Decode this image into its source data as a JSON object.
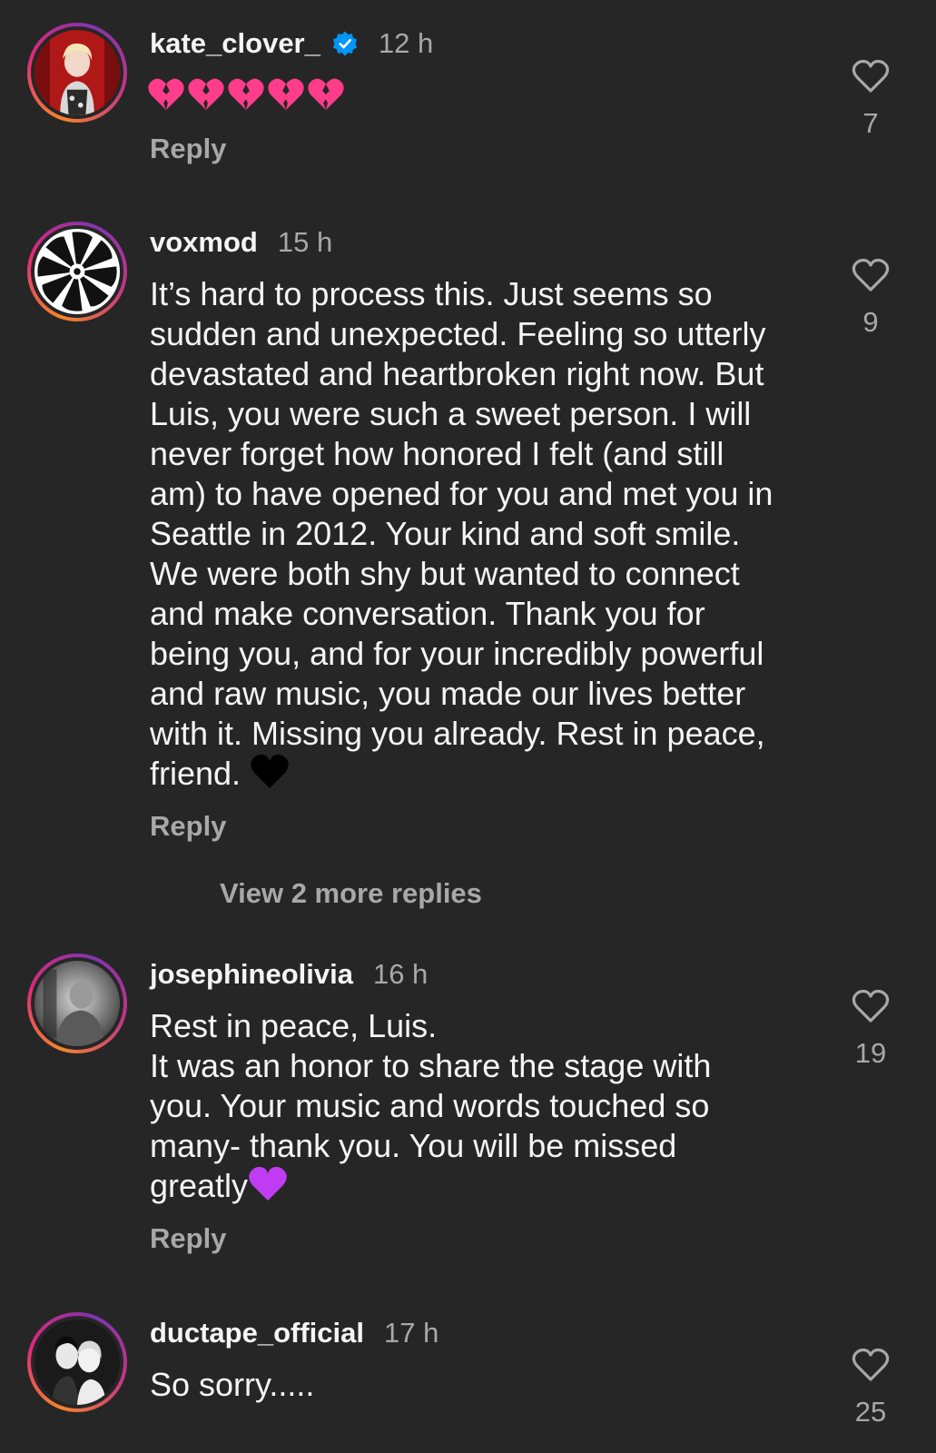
{
  "comments": [
    {
      "username": "kate_clover_",
      "verified": true,
      "time": "12 h",
      "text": "",
      "emoji": [
        "broken-heart-pink",
        "broken-heart-pink",
        "broken-heart-pink",
        "broken-heart-pink",
        "broken-heart-pink"
      ],
      "reply_label": "Reply",
      "likes": "7",
      "avatar": "kate-clover-avatar"
    },
    {
      "username": "voxmod",
      "verified": false,
      "time": "15 h",
      "text": "It’s hard to process this. Just seems so\nsudden and unexpected. Feeling so utterly\ndevastated and heartbroken right now. But\nLuis, you were such a sweet person. I will\nnever forget how honored I felt (and still\nam) to have opened for you and met you in\nSeattle in 2012. Your kind and soft smile.\nWe were both shy but wanted to connect\nand make conversation. Thank you for\nbeing you, and for your incredibly powerful\nand raw music, you made our lives better\nwith it. Missing you already. Rest in peace,\nfriend. ",
      "trailing_emoji": "black-heart",
      "reply_label": "Reply",
      "likes": "9",
      "view_more": "View 2 more replies",
      "avatar": "voxmod-avatar"
    },
    {
      "username": "josephineolivia",
      "verified": false,
      "time": "16 h",
      "text": "Rest in peace, Luis.\nIt was an honor to share the stage with\nyou. Your music and words touched so\nmany- thank you. You will be missed\ngreatly",
      "trailing_emoji": "purple-heart",
      "reply_label": "Reply",
      "likes": "19",
      "avatar": "josephineolivia-avatar"
    },
    {
      "username": "ductape_official",
      "verified": false,
      "time": "17 h",
      "text": "So sorry.....",
      "likes": "25",
      "avatar": "ductape-official-avatar"
    }
  ],
  "colors": {
    "background": "#262626",
    "primary_text": "#f5f5f5",
    "secondary_text": "#a8a8a8",
    "verified_blue": "#0095f6",
    "pink_heart": "#ff3d8b",
    "purple_heart": "#c03cf2"
  }
}
